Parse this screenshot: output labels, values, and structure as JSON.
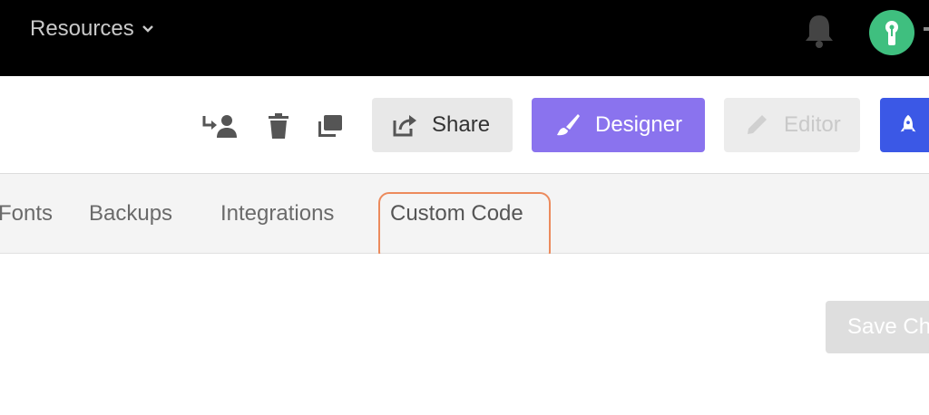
{
  "topbar": {
    "resources_label": "Resources",
    "icons": [
      "chevron-down-icon",
      "bell-icon",
      "avatar"
    ]
  },
  "toolbar": {
    "icons": [
      "transfer-user-icon",
      "trash-icon",
      "duplicate-icon"
    ],
    "share_label": "Share",
    "designer_label": "Designer",
    "editor_label": "Editor",
    "colors": {
      "designer": "#8a73ee",
      "editor": "#ececec",
      "launch": "#3b58e6"
    }
  },
  "tabs": [
    {
      "label": "Fonts"
    },
    {
      "label": "Backups"
    },
    {
      "label": "Integrations"
    },
    {
      "label": "Custom Code"
    }
  ],
  "highlight_color": "#ec8a5c",
  "content": {
    "save_label": "Save Ch"
  }
}
